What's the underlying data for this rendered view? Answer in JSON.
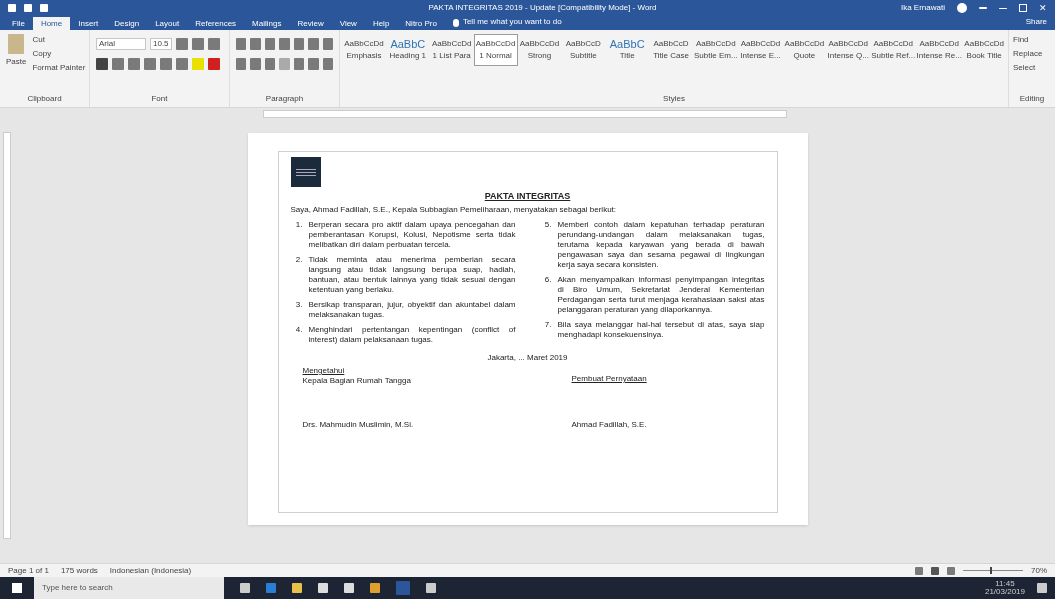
{
  "window": {
    "title": "PAKTA INTEGRITAS 2019 - Update [Compatibility Mode] - Word",
    "user": "Ika Ernawati",
    "close": "✕"
  },
  "tabs": [
    {
      "label": "File",
      "selected": false
    },
    {
      "label": "Home",
      "selected": true
    },
    {
      "label": "Insert",
      "selected": false
    },
    {
      "label": "Design",
      "selected": false
    },
    {
      "label": "Layout",
      "selected": false
    },
    {
      "label": "References",
      "selected": false
    },
    {
      "label": "Mailings",
      "selected": false
    },
    {
      "label": "Review",
      "selected": false
    },
    {
      "label": "View",
      "selected": false
    },
    {
      "label": "Help",
      "selected": false
    },
    {
      "label": "Nitro Pro",
      "selected": false
    }
  ],
  "tell_me": "Tell me what you want to do",
  "share": "Share",
  "clipboard": {
    "paste": "Paste",
    "cut": "Cut",
    "copy": "Copy",
    "format_painter": "Format Painter",
    "label": "Clipboard"
  },
  "font": {
    "name": "Arial",
    "size": "10.5",
    "label": "Font"
  },
  "paragraph": {
    "label": "Paragraph"
  },
  "styles": {
    "label": "Styles",
    "items": [
      {
        "sample": "AaBbCcDd",
        "name": "Emphasis",
        "selected": false
      },
      {
        "sample": "AaBbC",
        "name": "Heading 1",
        "selected": false
      },
      {
        "sample": "AaBbCcDd",
        "name": "1 List Para",
        "selected": false
      },
      {
        "sample": "AaBbCcDd",
        "name": "1 Normal",
        "selected": true
      },
      {
        "sample": "AaBbCcDd",
        "name": "Strong",
        "selected": false
      },
      {
        "sample": "AaBbCcD",
        "name": "Subtitle",
        "selected": false
      },
      {
        "sample": "AaBbC",
        "name": "Title",
        "selected": false
      },
      {
        "sample": "AaBbCcD",
        "name": "Title Case",
        "selected": false
      },
      {
        "sample": "AaBbCcDd",
        "name": "Subtle Em...",
        "selected": false
      },
      {
        "sample": "AaBbCcDd",
        "name": "Intense E...",
        "selected": false
      },
      {
        "sample": "AaBbCcDd",
        "name": "Quote",
        "selected": false
      },
      {
        "sample": "AaBbCcDd",
        "name": "Intense Q...",
        "selected": false
      },
      {
        "sample": "AaBbCcDd",
        "name": "Subtle Ref...",
        "selected": false
      },
      {
        "sample": "AaBbCcDd",
        "name": "Intense Re...",
        "selected": false
      },
      {
        "sample": "AaBbCcDd",
        "name": "Book Title",
        "selected": false
      }
    ]
  },
  "editing": {
    "find": "Find",
    "replace": "Replace",
    "select": "Select",
    "label": "Editing"
  },
  "document": {
    "title": "PAKTA INTEGRITAS",
    "intro": "Saya, Ahmad Fadillah, S.E., Kepala Subbagian Pemeliharaan, menyatakan sebagai berikut:",
    "items_left": [
      {
        "number": "1.",
        "text": "Berperan secara pro aktif dalam upaya pencegahan dan pemberantasan Korupsi, Kolusi, Nepotisme serta tidak melibatkan diri dalam perbuatan tercela."
      },
      {
        "number": "2.",
        "text": "Tidak meminta atau menerima pemberian secara langsung atau tidak langsung berupa suap, hadiah, bantuan, atau bentuk lainnya yang tidak sesuai dengan ketentuan yang berlaku."
      },
      {
        "number": "3.",
        "text": "Bersikap transparan, jujur, obyektif dan akuntabel dalam melaksanakan tugas."
      },
      {
        "number": "4.",
        "text": "Menghindari pertentangan kepentingan (conflict of interest) dalam pelaksanaan tugas."
      }
    ],
    "items_right": [
      {
        "number": "5.",
        "text": "Memberi contoh dalam kepatuhan terhadap peraturan perundang-undangan dalam melaksanakan tugas, terutama kepada karyawan yang berada di bawah pengawasan saya dan sesama pegawai di lingkungan kerja saya secara konsisten."
      },
      {
        "number": "6.",
        "text": "Akan menyampaikan informasi penyimpangan integritas di Biro Umum, Sekretariat Jenderal Kementerian Perdagangan serta turut menjaga kerahasiaan saksi atas pelanggaran peraturan yang dilaporkannya."
      },
      {
        "number": "7.",
        "text": "Bila saya melanggar hal-hal tersebut di atas, saya siap menghadapi konsekuensinya."
      }
    ],
    "date": "Jakarta, ... Maret 2019",
    "left_sign": {
      "role": "Mengetahui",
      "position": "Kepala Bagian Rumah Tangga",
      "name": "Drs. Mahmudin Muslimin, M.Si."
    },
    "right_sign": {
      "position": "Pembuat Pernyataan",
      "name": "Ahmad Fadillah, S.E."
    }
  },
  "status_bar": {
    "page": "Page 1 of 1",
    "words": "175 words",
    "language": "Indonesian (Indonesia)",
    "zoom": "70%",
    "zoom_slider": {
      "level": 0.47
    }
  },
  "taskbar": {
    "search_placeholder": "Type here to search",
    "time": "11:45",
    "date": "21/03/2019"
  }
}
